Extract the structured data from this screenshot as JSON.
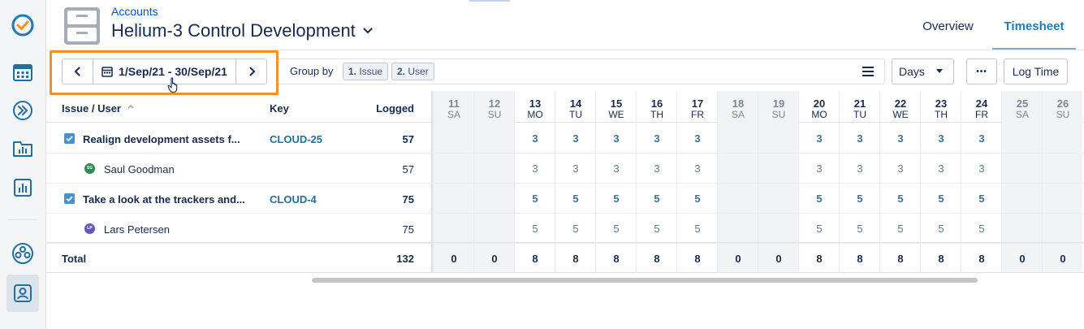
{
  "header": {
    "breadcrumb": "Accounts",
    "title": "Helium-3 Control Development",
    "tabs": [
      {
        "label": "Overview",
        "active": false
      },
      {
        "label": "Timesheet",
        "active": true
      }
    ]
  },
  "toolbar": {
    "date_range": "1/Sep/21 - 30/Sep/21",
    "group_by_label": "Group by",
    "group_chips": [
      {
        "num": "1.",
        "label": "Issue"
      },
      {
        "num": "2.",
        "label": "User"
      }
    ],
    "period_select": "Days",
    "more_label": "•••",
    "log_time_label": "Log Time"
  },
  "table": {
    "columns": {
      "issue_user": "Issue / User",
      "key": "Key",
      "logged": "Logged"
    },
    "days": [
      {
        "num": "11",
        "abbr": "SA",
        "weekend": true
      },
      {
        "num": "12",
        "abbr": "SU",
        "weekend": true
      },
      {
        "num": "13",
        "abbr": "MO",
        "weekend": false
      },
      {
        "num": "14",
        "abbr": "TU",
        "weekend": false
      },
      {
        "num": "15",
        "abbr": "WE",
        "weekend": false
      },
      {
        "num": "16",
        "abbr": "TH",
        "weekend": false
      },
      {
        "num": "17",
        "abbr": "FR",
        "weekend": false
      },
      {
        "num": "18",
        "abbr": "SA",
        "weekend": true
      },
      {
        "num": "19",
        "abbr": "SU",
        "weekend": true
      },
      {
        "num": "20",
        "abbr": "MO",
        "weekend": false
      },
      {
        "num": "21",
        "abbr": "TU",
        "weekend": false
      },
      {
        "num": "22",
        "abbr": "WE",
        "weekend": false
      },
      {
        "num": "23",
        "abbr": "TH",
        "weekend": false
      },
      {
        "num": "24",
        "abbr": "FR",
        "weekend": false
      },
      {
        "num": "25",
        "abbr": "SA",
        "weekend": true
      },
      {
        "num": "26",
        "abbr": "SU",
        "weekend": true
      }
    ],
    "rows": [
      {
        "type": "issue",
        "title": "Realign development assets f...",
        "key": "CLOUD-25",
        "logged": "57",
        "values": [
          "",
          "",
          "3",
          "3",
          "3",
          "3",
          "3",
          "",
          "",
          "3",
          "3",
          "3",
          "3",
          "3",
          "",
          ""
        ]
      },
      {
        "type": "user",
        "title": "Saul Goodman",
        "initials": "SG",
        "avatar_color": "#2e8b57",
        "key": "",
        "logged": "57",
        "values": [
          "",
          "",
          "3",
          "3",
          "3",
          "3",
          "3",
          "",
          "",
          "3",
          "3",
          "3",
          "3",
          "3",
          "",
          ""
        ]
      },
      {
        "type": "issue",
        "title": "Take a look at the trackers and...",
        "key": "CLOUD-4",
        "logged": "75",
        "values": [
          "",
          "",
          "5",
          "5",
          "5",
          "5",
          "5",
          "",
          "",
          "5",
          "5",
          "5",
          "5",
          "5",
          "",
          ""
        ]
      },
      {
        "type": "user",
        "title": "Lars Petersen",
        "initials": "LP",
        "avatar_color": "#6554c0",
        "key": "",
        "logged": "75",
        "values": [
          "",
          "",
          "5",
          "5",
          "5",
          "5",
          "5",
          "",
          "",
          "5",
          "5",
          "5",
          "5",
          "5",
          "",
          ""
        ]
      }
    ],
    "total": {
      "label": "Total",
      "logged": "132",
      "values": [
        "0",
        "0",
        "8",
        "8",
        "8",
        "8",
        "8",
        "0",
        "0",
        "8",
        "8",
        "8",
        "8",
        "8",
        "0",
        "0"
      ]
    }
  },
  "colors": {
    "accent": "#1f7bb5",
    "key_link": "#1f6f9f",
    "highlight": "#f39222",
    "checkbox": "#4a8fd0"
  }
}
